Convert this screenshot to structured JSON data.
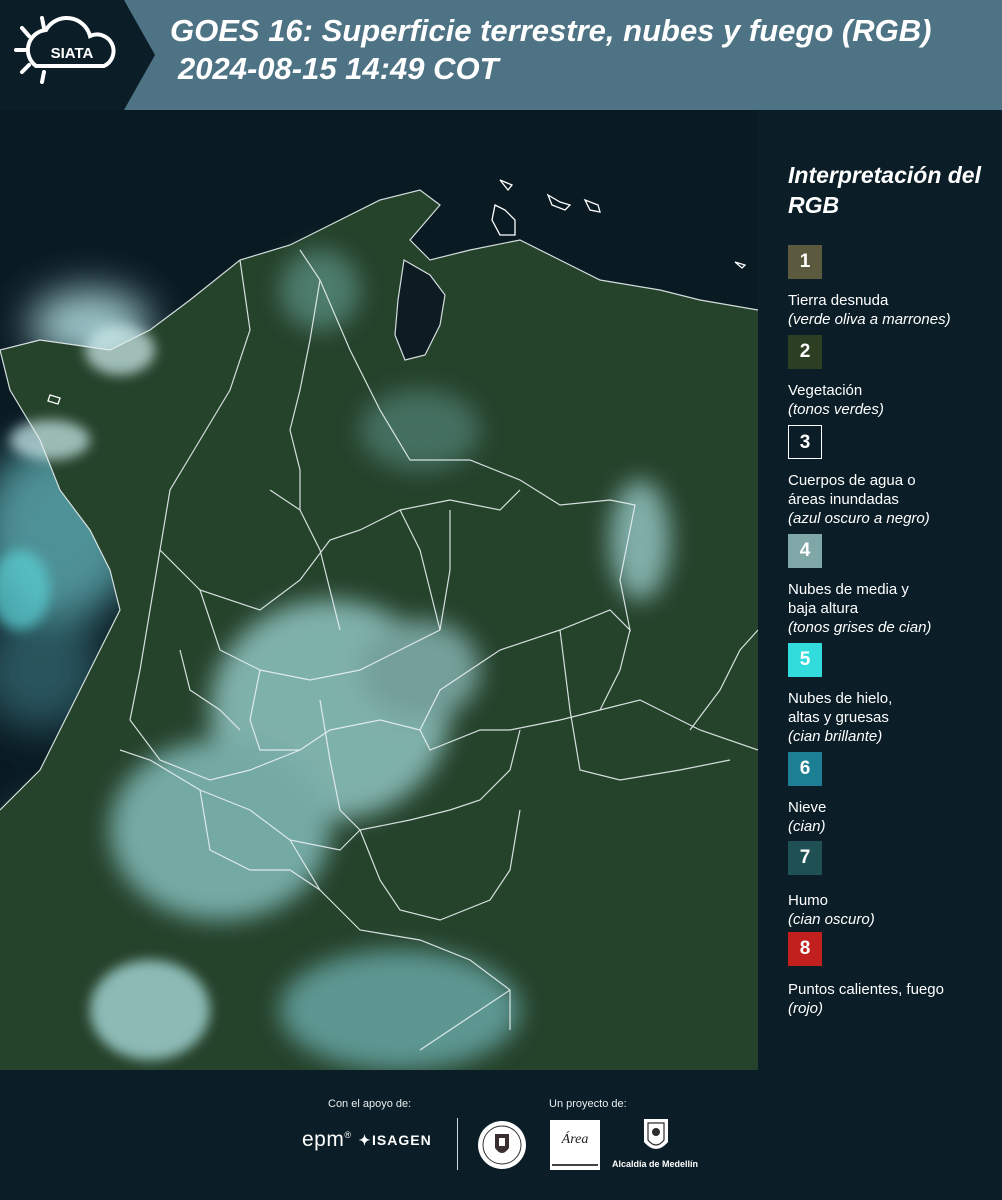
{
  "header": {
    "logo_text": "SIATA",
    "title_line1": "GOES 16: Superficie terrestre, nubes y fuego (RGB)",
    "title_line2": "2024-08-15 14:49 COT"
  },
  "legend": {
    "title": "Interpretación del RGB",
    "items": [
      {
        "number": "1",
        "label": "Tierra desnuda",
        "desc": "(verde oliva a marrones)",
        "color": "#5c5a3e"
      },
      {
        "number": "2",
        "label": "Vegetación",
        "desc": "(tonos verdes)",
        "color": "#2c3f22"
      },
      {
        "number": "3",
        "label": "Cuerpos de agua o áreas inundadas",
        "desc": "(azul oscuro a negro)",
        "color": "#0b1d26"
      },
      {
        "number": "4",
        "label": "Nubes de media y baja altura",
        "desc": "(tonos grises de cian)",
        "color": "#7fa7a8"
      },
      {
        "number": "5",
        "label": "Nubes de hielo, altas y gruesas",
        "desc": "(cian brillante)",
        "color": "#33dcdc"
      },
      {
        "number": "6",
        "label": "Nieve",
        "desc": "(cian)",
        "color": "#1c7f93"
      },
      {
        "number": "7",
        "label": "Humo",
        "desc": "(cian oscuro)",
        "color": "#1e5054"
      },
      {
        "number": "8",
        "label": "Puntos calientes, fuego",
        "desc": "(rojo)",
        "color": "#c21f1f"
      }
    ]
  },
  "footer": {
    "support_label": "Con el apoyo de:",
    "project_label": "Un proyecto de:",
    "epm": "epm",
    "isagen": "ISAGEN",
    "area_logo_text": "Área",
    "alcaldia": "Alcaldía de Medellín"
  },
  "colors": {
    "header_bg": "#4d7385",
    "page_bg": "#0b1d26",
    "vegetation": "#2c4a2c",
    "clouds": "#a6e8ea",
    "water": "#0a1a20"
  }
}
